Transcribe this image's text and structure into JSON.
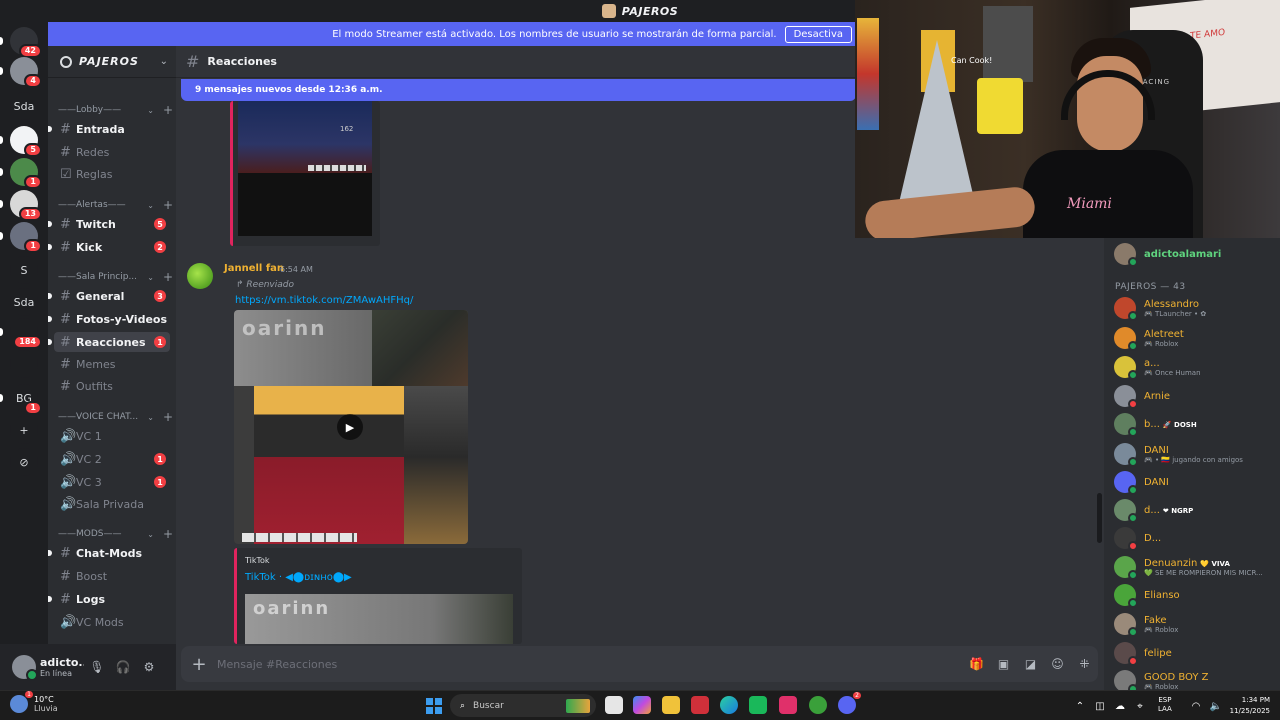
{
  "window": {
    "title": "PAJEROS"
  },
  "banner": {
    "text": "El modo Streamer está activado. Los nombres de usuario se mostrarán de forma parcial.",
    "button": "Desactiva"
  },
  "rail": {
    "items": [
      {
        "label": "",
        "badge": "42",
        "color": "#313338",
        "icon": "discord-home-icon"
      },
      {
        "label": "",
        "badge": "4",
        "color": "#8a8f98",
        "icon": "server-avatar"
      },
      {
        "label": "Sda",
        "badge": "",
        "color": "#1e1f22",
        "icon": ""
      },
      {
        "label": "",
        "badge": "5",
        "color": "#f2f3f5",
        "icon": "server-maple-icon"
      },
      {
        "label": "",
        "badge": "1",
        "color": "#4c8a4a",
        "icon": "server-avatar"
      },
      {
        "label": "",
        "badge": "13",
        "color": "#d8d8d8",
        "icon": "server-avatar"
      },
      {
        "label": "",
        "badge": "1",
        "color": "#6a7080",
        "icon": "server-avatar"
      },
      {
        "label": "S",
        "badge": "",
        "color": "#1e1f22",
        "icon": ""
      },
      {
        "label": "Sda",
        "badge": "",
        "color": "#1e1f22",
        "icon": ""
      },
      {
        "label": "",
        "badge": "184",
        "color": "#1e1f22",
        "icon": "server-tiktok-icon"
      },
      {
        "label": "",
        "badge": "",
        "color": "#1e1f22",
        "icon": "server-kick-icon"
      },
      {
        "label": "BG",
        "badge": "1",
        "color": "#1e1f22",
        "icon": ""
      },
      {
        "label": "+",
        "badge": "",
        "color": "#1e1f22",
        "icon": "add-server-icon"
      },
      {
        "label": "⊘",
        "badge": "",
        "color": "#1e1f22",
        "icon": "explore-icon"
      }
    ]
  },
  "guild": {
    "name": "PAJEROS"
  },
  "categories": [
    {
      "label": "——Lobby——"
    },
    {
      "label": "——Alertas——"
    },
    {
      "label": "——Sala Princip..."
    },
    {
      "label": "——VOICE CHAT..."
    },
    {
      "label": "——MODS——"
    }
  ],
  "channels": [
    {
      "label": "Entrada",
      "badge": "",
      "icon": "#"
    },
    {
      "label": "Redes",
      "badge": "",
      "icon": "#"
    },
    {
      "label": "Reglas",
      "badge": "",
      "icon": "☑"
    },
    {
      "label": "Twitch",
      "badge": "5",
      "icon": "#"
    },
    {
      "label": "Kick",
      "badge": "2",
      "icon": "#"
    },
    {
      "label": "General",
      "badge": "3",
      "icon": "#"
    },
    {
      "label": "Fotos-y-Videos",
      "badge": "",
      "icon": "#"
    },
    {
      "label": "Reacciones",
      "badge": "1",
      "icon": "#"
    },
    {
      "label": "Memes",
      "badge": "",
      "icon": "#"
    },
    {
      "label": "Outfits",
      "badge": "",
      "icon": "#"
    },
    {
      "label": "VC 1",
      "badge": "",
      "icon": "🔊"
    },
    {
      "label": "VC 2",
      "badge": "1",
      "icon": "🔊"
    },
    {
      "label": "VC 3",
      "badge": "1",
      "icon": "🔊"
    },
    {
      "label": "Sala Privada",
      "badge": "",
      "icon": "🔊"
    },
    {
      "label": "Chat-Mods",
      "badge": "",
      "icon": "#"
    },
    {
      "label": "Boost",
      "badge": "",
      "icon": "#"
    },
    {
      "label": "Logs",
      "badge": "",
      "icon": "#"
    },
    {
      "label": "VC Mods",
      "badge": "",
      "icon": "🔊"
    }
  ],
  "user": {
    "name": "adicto...",
    "status": "En línea"
  },
  "chat": {
    "channel": "Reacciones",
    "new_messages": "9 mensajes nuevos desde 12:36 a.m.",
    "prev_embed_number": "162",
    "message": {
      "author": "Jannell fan",
      "time": "6:54 AM",
      "forwarded": "↱ Reenviado",
      "link": "https://vm.tiktok.com/ZMAwAHFHq/",
      "video_watermark": "oarinn",
      "embed_provider": "TikTok",
      "embed_title": "TikTok · ◀⬤ᴅɪɴʜᴏ⬤▶",
      "embed_watermark": "oarinn"
    },
    "composer_placeholder": "Mensaje #Reacciones"
  },
  "webcam": {
    "poster_text": "Can Cook!",
    "chair_label": "DXRACING",
    "shirt_text": "Miami",
    "board_text": "TE AMO"
  },
  "members": {
    "top_member": {
      "name": "adictoalamari"
    },
    "category": "PAJEROS — 43",
    "list": [
      {
        "name": "Alessandro",
        "activity": "🎮 TLauncher • ✿",
        "color": "#c0472c",
        "tag": ""
      },
      {
        "name": "Aletreet",
        "activity": "🎮 Roblox",
        "color": "#e08a2a",
        "tag": ""
      },
      {
        "name": "a...",
        "activity": "🎮 Once Human",
        "color": "#d9c23a",
        "tag": ""
      },
      {
        "name": "Arnie",
        "activity": "",
        "color": "#8a8f98",
        "tag": ""
      },
      {
        "name": "b...",
        "activity": "",
        "color": "#5f7f5f",
        "tag": "🚀 DOSH"
      },
      {
        "name": "DANI",
        "activity": "🎮 • 🇨🇴 jugando con amigos",
        "color": "#7a8a9a",
        "tag": ""
      },
      {
        "name": "DANI",
        "activity": "",
        "color": "#5865f2",
        "tag": ""
      },
      {
        "name": "d...",
        "activity": "",
        "color": "#6a8a6a",
        "tag": "❤ NGRP"
      },
      {
        "name": "D...",
        "activity": "",
        "color": "#3a3a3a",
        "tag": ""
      },
      {
        "name": "Denuanzin",
        "activity": "💚 SE ME ROMPIERON MIS MICR...",
        "color": "#5aa54a",
        "tag": "💛 VIVA"
      },
      {
        "name": "Elianso",
        "activity": "",
        "color": "#4aa53a",
        "tag": ""
      },
      {
        "name": "Fake",
        "activity": "🎮 Roblox",
        "color": "#9a8a7a",
        "tag": ""
      },
      {
        "name": "felipe",
        "activity": "",
        "color": "#5a4a4a",
        "tag": ""
      },
      {
        "name": "GOOD BOY Z",
        "activity": "🎮 Roblox",
        "color": "#7a7a7a",
        "tag": ""
      }
    ]
  },
  "taskbar": {
    "weather_temp": "10°C",
    "weather_desc": "Lluvia",
    "weather_badge": "1",
    "search": "Buscar",
    "lang1": "ESP",
    "lang2": "LAA",
    "time": "1:34 PM",
    "date": "11/25/2025",
    "discord_badge": "2"
  }
}
